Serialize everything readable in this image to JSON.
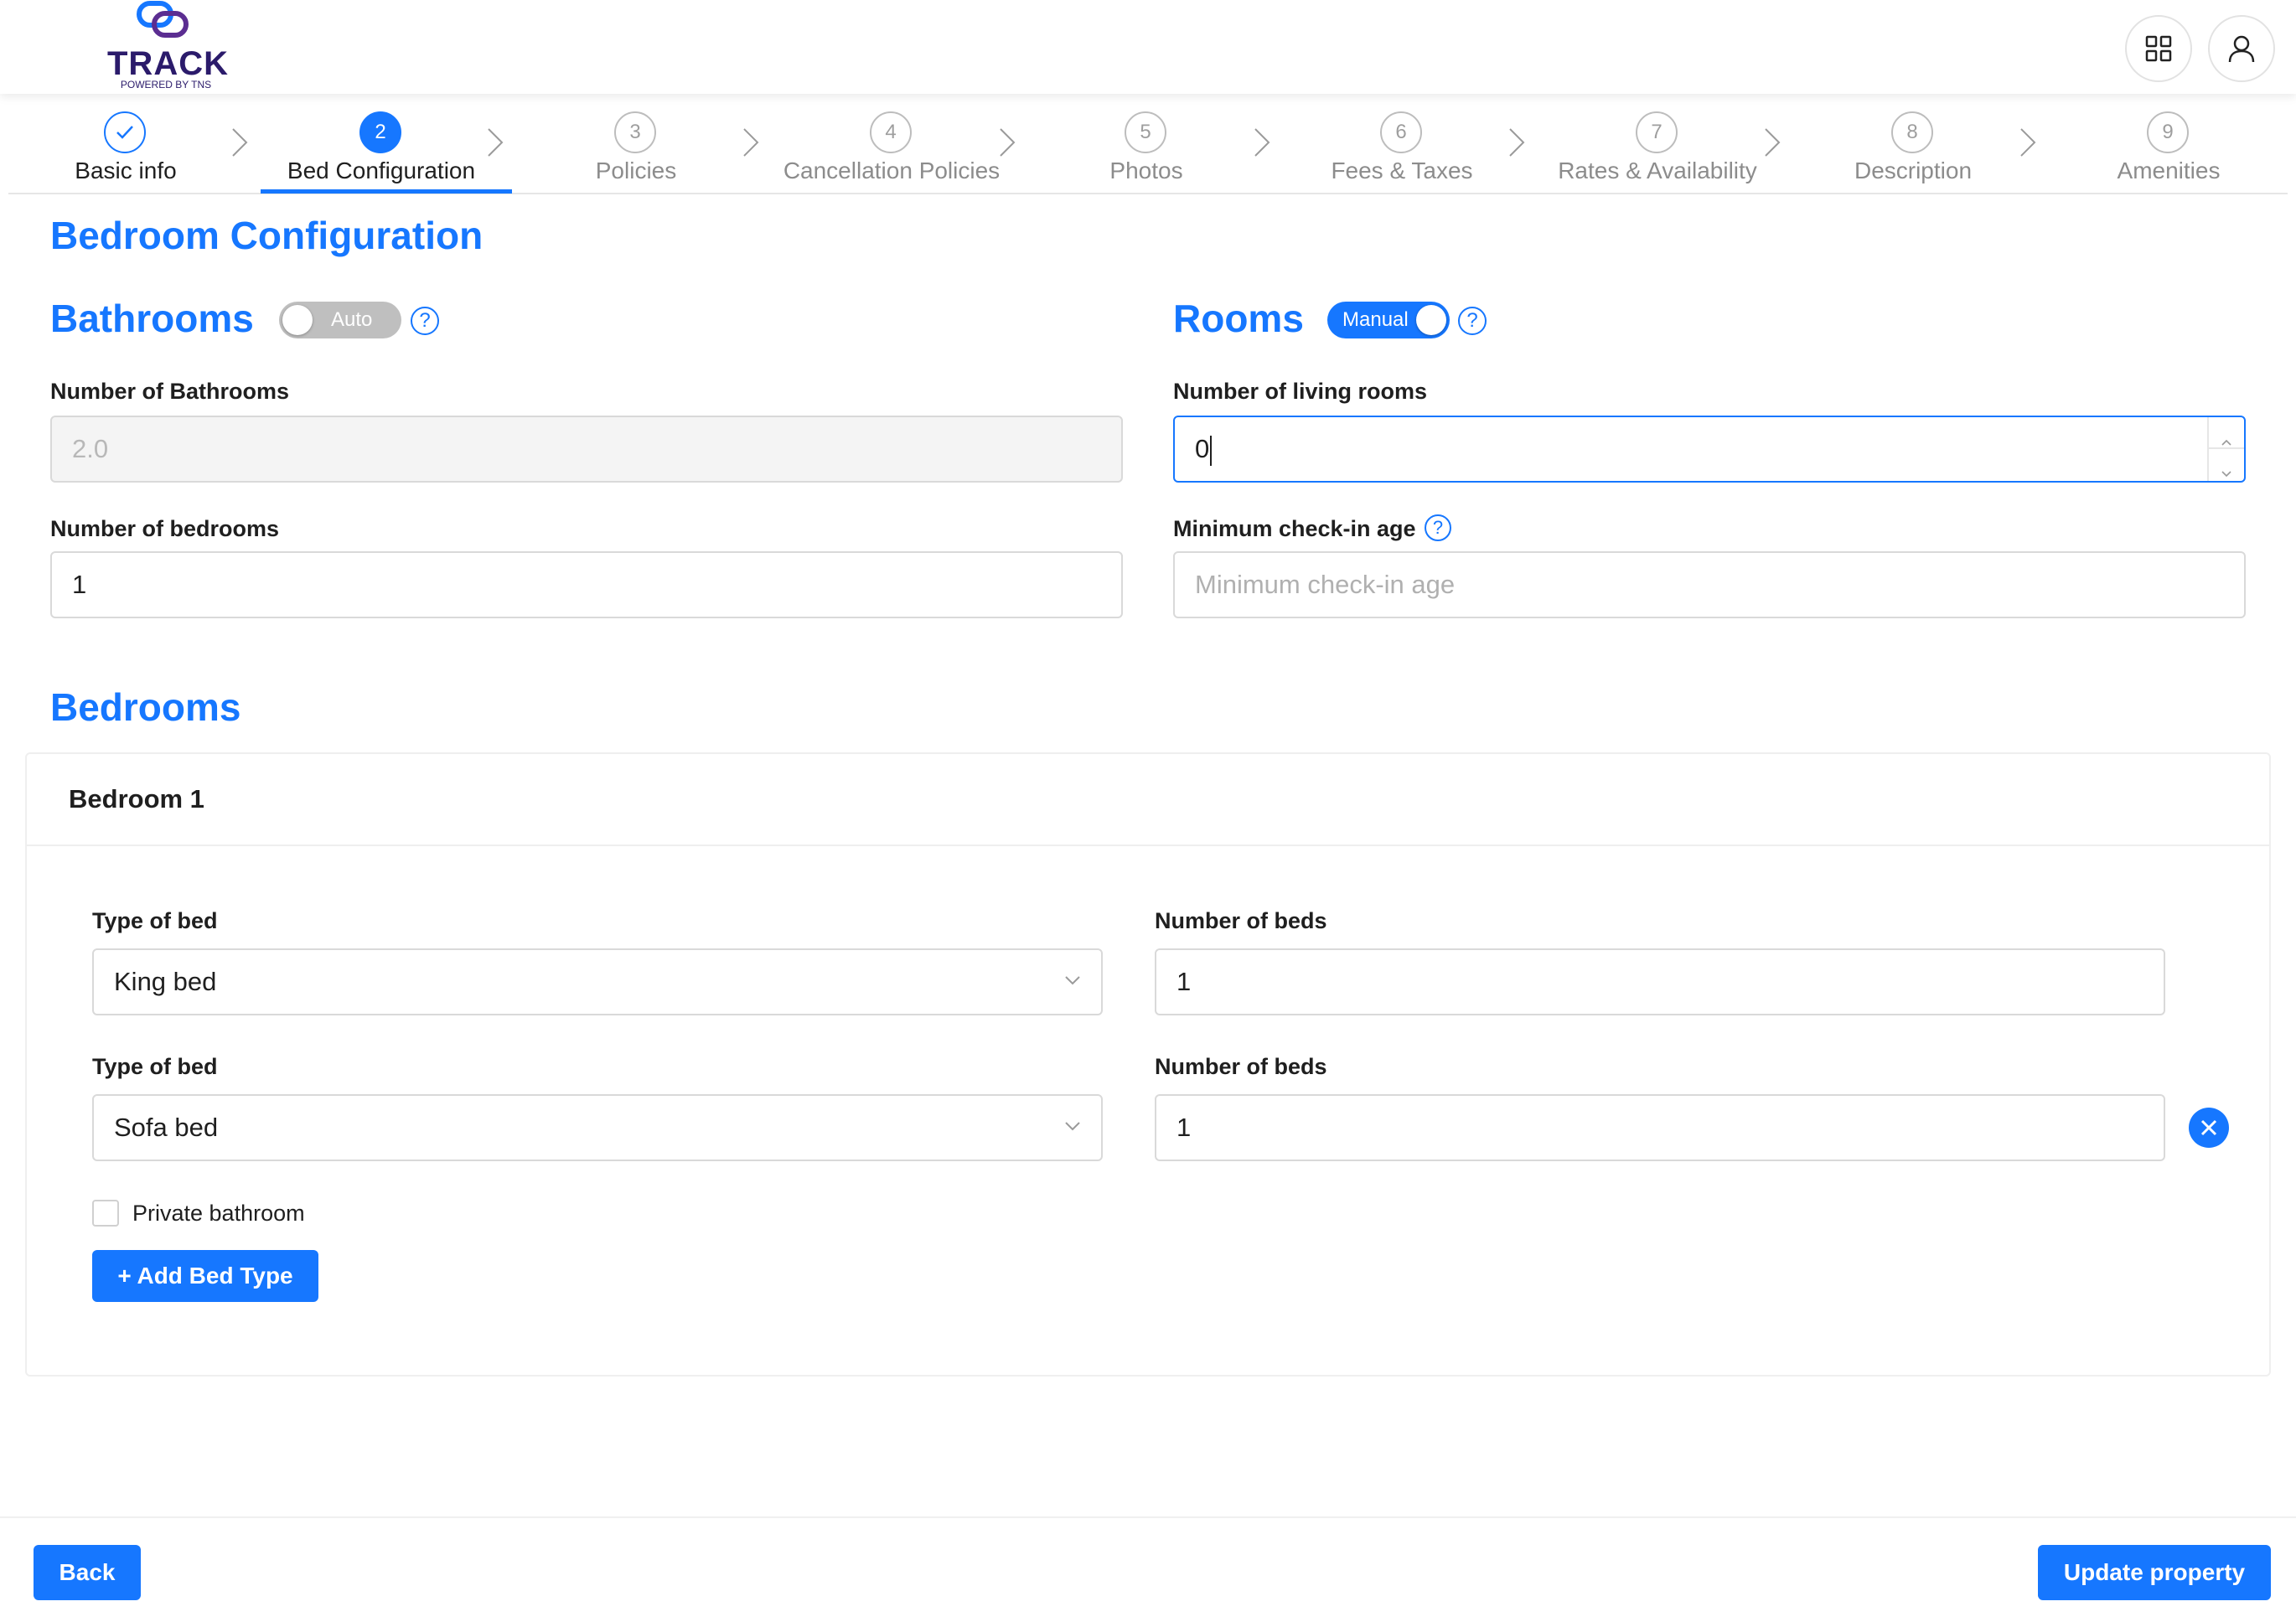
{
  "header": {
    "logo_text": "TRACK",
    "logo_subtext": "POWERED BY TNS",
    "apps_icon": "grid-icon",
    "user_icon": "user-icon"
  },
  "stepper": {
    "steps": [
      {
        "number": "1",
        "label": "Basic info",
        "state": "done"
      },
      {
        "number": "2",
        "label": "Bed Configuration",
        "state": "active"
      },
      {
        "number": "3",
        "label": "Policies",
        "state": "pending"
      },
      {
        "number": "4",
        "label": "Cancellation Policies",
        "state": "pending"
      },
      {
        "number": "5",
        "label": "Photos",
        "state": "pending"
      },
      {
        "number": "6",
        "label": "Fees & Taxes",
        "state": "pending"
      },
      {
        "number": "7",
        "label": "Rates & Availability",
        "state": "pending"
      },
      {
        "number": "8",
        "label": "Description",
        "state": "pending"
      },
      {
        "number": "9",
        "label": "Amenities",
        "state": "pending"
      }
    ]
  },
  "page_title": "Bedroom Configuration",
  "bathrooms": {
    "heading": "Bathrooms",
    "toggle_label": "Auto",
    "toggle_on": false,
    "help": "?",
    "num_bathrooms_label": "Number of Bathrooms",
    "num_bathrooms_value": "2.0",
    "num_bedrooms_label": "Number of bedrooms",
    "num_bedrooms_value": "1"
  },
  "rooms": {
    "heading": "Rooms",
    "toggle_label": "Manual",
    "toggle_on": true,
    "help": "?",
    "living_rooms_label": "Number of living rooms",
    "living_rooms_value": "0",
    "checkin_label": "Minimum check-in age",
    "checkin_help": "?",
    "checkin_placeholder": "Minimum check-in age"
  },
  "bedrooms": {
    "heading": "Bedrooms",
    "cards": [
      {
        "title": "Bedroom 1",
        "beds": [
          {
            "type_label": "Type of bed",
            "type_value": "King bed",
            "count_label": "Number of beds",
            "count_value": "1"
          },
          {
            "type_label": "Type of bed",
            "type_value": "Sofa bed",
            "count_label": "Number of beds",
            "count_value": "1"
          }
        ],
        "private_bathroom_label": "Private bathroom",
        "private_bathroom_checked": false,
        "add_bed_type_label": "+ Add Bed Type"
      }
    ]
  },
  "footer": {
    "back_label": "Back",
    "update_label": "Update property"
  },
  "colors": {
    "accent": "#1677ff",
    "logo": "#2b1b6b"
  }
}
